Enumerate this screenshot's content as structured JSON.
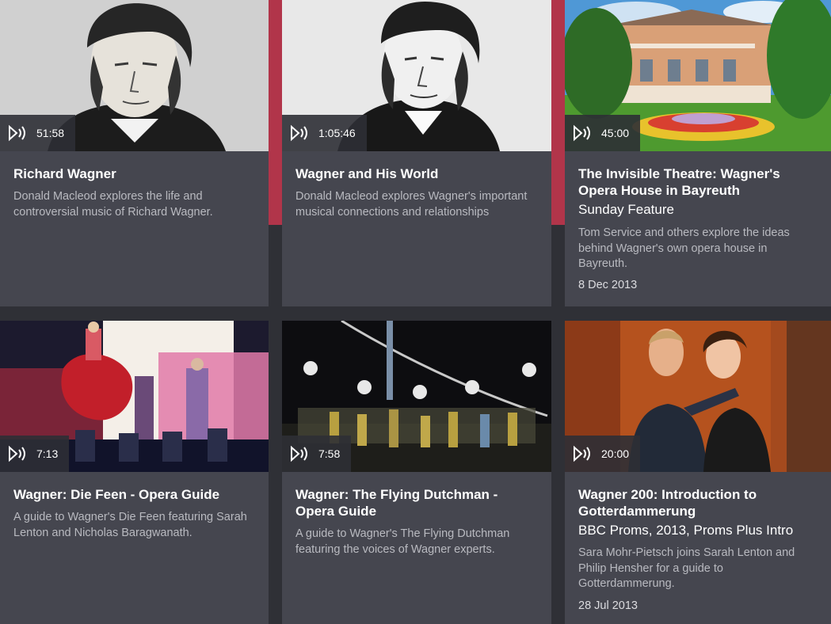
{
  "cards": [
    {
      "duration": "51:58",
      "title": "Richard Wagner",
      "description": "Donald Macleod explores the life and controversial music of Richard Wagner."
    },
    {
      "duration": "1:05:46",
      "title": "Wagner and His World",
      "description": "Donald Macleod explores Wagner's important musical connections and relationships"
    },
    {
      "duration": "45:00",
      "title": "The Invisible Theatre: Wagner's Opera House in Bayreuth",
      "subtitle": "Sunday Feature",
      "description": "Tom Service and others explore the ideas behind Wagner's own opera house in Bayreuth.",
      "date": "8 Dec 2013"
    },
    {
      "duration": "7:13",
      "title": "Wagner: Die Feen - Opera Guide",
      "description": "A guide to Wagner's Die Feen featuring Sarah Lenton and Nicholas Baragwanath."
    },
    {
      "duration": "7:58",
      "title": "Wagner: The Flying Dutchman - Opera Guide",
      "description": "A guide to Wagner's The Flying Dutchman featuring the voices of Wagner experts."
    },
    {
      "duration": "20:00",
      "title": "Wagner 200: Introduction to Gotterdammerung",
      "subtitle": "BBC Proms, 2013, Proms Plus Intro",
      "description": "Sara Mohr-Pietsch joins Sarah Lenton and Philip Hensher for a guide to Gotterdammerung.",
      "date": "28 Jul 2013"
    }
  ],
  "colors": {
    "background": "#2f3036",
    "card": "#45464f",
    "accent": "#b1354a",
    "description": "#b9bac0"
  },
  "icons": {
    "duration_badge": "audio-play-icon"
  }
}
